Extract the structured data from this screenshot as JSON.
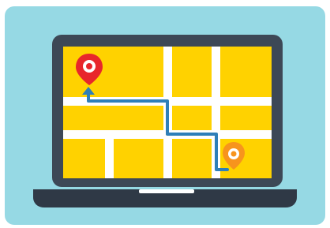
{
  "illustration": {
    "icons": [
      "laptop-icon",
      "map-icon",
      "route-icon",
      "origin-pin-icon",
      "destination-pin-icon"
    ]
  },
  "colors": {
    "background": "#96d9e4",
    "laptop_frame": "#3d4856",
    "laptop_base": "#2f3946",
    "screen_map": "#ffd200",
    "street": "#ffffff",
    "route": "#2f7fb8",
    "origin_pin": "#e8262b",
    "destination_pin": "#f7941d",
    "pin_center": "#ffffff"
  }
}
